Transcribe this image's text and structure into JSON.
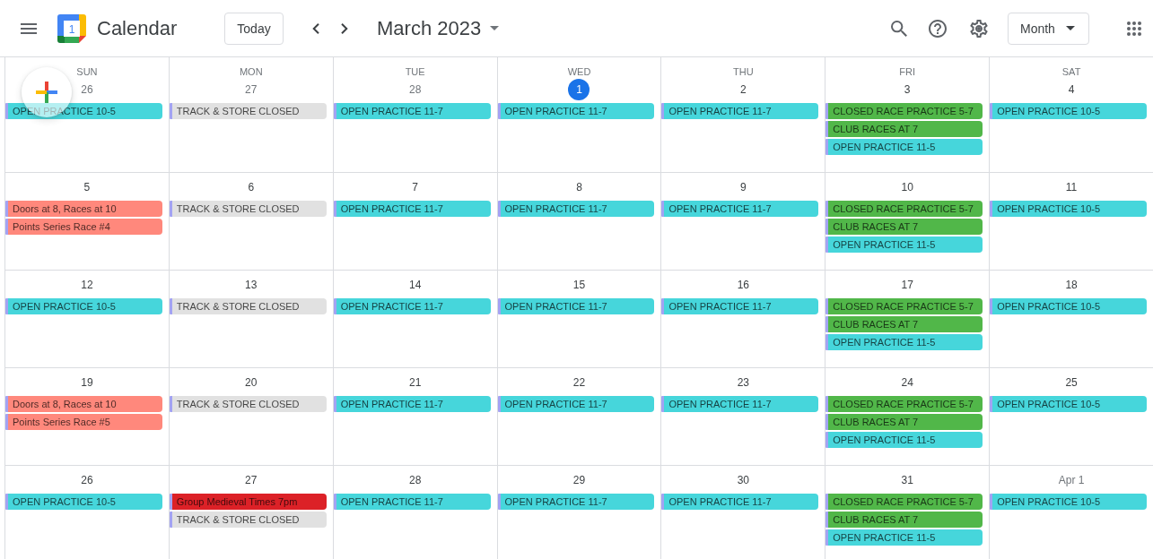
{
  "header": {
    "logo_number": "1",
    "app_name": "Calendar",
    "today_button": "Today",
    "period": "March 2023",
    "view_button": "Month"
  },
  "weekdays": [
    "SUN",
    "MON",
    "TUE",
    "WED",
    "THU",
    "FRI",
    "SAT"
  ],
  "weeks": [
    {
      "days": [
        {
          "date": "26",
          "in_month": false,
          "today": false,
          "events": [
            {
              "title": "OPEN PRACTICE 10-5",
              "color": "#46d6db"
            }
          ]
        },
        {
          "date": "27",
          "in_month": false,
          "today": false,
          "events": [
            {
              "title": "TRACK & STORE CLOSED",
              "color": "#e1e1e1"
            }
          ]
        },
        {
          "date": "28",
          "in_month": false,
          "today": false,
          "events": [
            {
              "title": "OPEN PRACTICE 11-7",
              "color": "#46d6db"
            }
          ]
        },
        {
          "date": "1",
          "in_month": true,
          "today": true,
          "events": [
            {
              "title": "OPEN PRACTICE 11-7",
              "color": "#46d6db"
            }
          ]
        },
        {
          "date": "2",
          "in_month": true,
          "today": false,
          "events": [
            {
              "title": "OPEN PRACTICE 11-7",
              "color": "#46d6db"
            }
          ]
        },
        {
          "date": "3",
          "in_month": true,
          "today": false,
          "events": [
            {
              "title": "CLOSED RACE PRACTICE 5-7",
              "color": "#51b749"
            },
            {
              "title": "CLUB RACES AT 7",
              "color": "#51b749"
            },
            {
              "title": "OPEN PRACTICE 11-5",
              "color": "#46d6db"
            }
          ]
        },
        {
          "date": "4",
          "in_month": true,
          "today": false,
          "events": [
            {
              "title": "OPEN PRACTICE 10-5",
              "color": "#46d6db"
            }
          ]
        }
      ]
    },
    {
      "days": [
        {
          "date": "5",
          "in_month": true,
          "today": false,
          "events": [
            {
              "title": "Doors at 8, Races at 10",
              "color": "#ff887c"
            },
            {
              "title": "Points Series Race #4",
              "color": "#ff887c"
            }
          ]
        },
        {
          "date": "6",
          "in_month": true,
          "today": false,
          "events": [
            {
              "title": "TRACK & STORE CLOSED",
              "color": "#e1e1e1"
            }
          ]
        },
        {
          "date": "7",
          "in_month": true,
          "today": false,
          "events": [
            {
              "title": "OPEN PRACTICE 11-7",
              "color": "#46d6db"
            }
          ]
        },
        {
          "date": "8",
          "in_month": true,
          "today": false,
          "events": [
            {
              "title": "OPEN PRACTICE 11-7",
              "color": "#46d6db"
            }
          ]
        },
        {
          "date": "9",
          "in_month": true,
          "today": false,
          "events": [
            {
              "title": "OPEN PRACTICE 11-7",
              "color": "#46d6db"
            }
          ]
        },
        {
          "date": "10",
          "in_month": true,
          "today": false,
          "events": [
            {
              "title": "CLOSED RACE PRACTICE 5-7",
              "color": "#51b749"
            },
            {
              "title": "CLUB RACES AT 7",
              "color": "#51b749"
            },
            {
              "title": "OPEN PRACTICE 11-5",
              "color": "#46d6db"
            }
          ]
        },
        {
          "date": "11",
          "in_month": true,
          "today": false,
          "events": [
            {
              "title": "OPEN PRACTICE 10-5",
              "color": "#46d6db"
            }
          ]
        }
      ]
    },
    {
      "days": [
        {
          "date": "12",
          "in_month": true,
          "today": false,
          "events": [
            {
              "title": "OPEN PRACTICE 10-5",
              "color": "#46d6db"
            }
          ]
        },
        {
          "date": "13",
          "in_month": true,
          "today": false,
          "events": [
            {
              "title": "TRACK & STORE CLOSED",
              "color": "#e1e1e1"
            }
          ]
        },
        {
          "date": "14",
          "in_month": true,
          "today": false,
          "events": [
            {
              "title": "OPEN PRACTICE 11-7",
              "color": "#46d6db"
            }
          ]
        },
        {
          "date": "15",
          "in_month": true,
          "today": false,
          "events": [
            {
              "title": "OPEN PRACTICE 11-7",
              "color": "#46d6db"
            }
          ]
        },
        {
          "date": "16",
          "in_month": true,
          "today": false,
          "events": [
            {
              "title": "OPEN PRACTICE 11-7",
              "color": "#46d6db"
            }
          ]
        },
        {
          "date": "17",
          "in_month": true,
          "today": false,
          "events": [
            {
              "title": "CLOSED RACE PRACTICE 5-7",
              "color": "#51b749"
            },
            {
              "title": "CLUB RACES AT 7",
              "color": "#51b749"
            },
            {
              "title": "OPEN PRACTICE 11-5",
              "color": "#46d6db"
            }
          ]
        },
        {
          "date": "18",
          "in_month": true,
          "today": false,
          "events": [
            {
              "title": "OPEN PRACTICE 10-5",
              "color": "#46d6db"
            }
          ]
        }
      ]
    },
    {
      "days": [
        {
          "date": "19",
          "in_month": true,
          "today": false,
          "events": [
            {
              "title": "Doors at 8, Races at 10",
              "color": "#ff887c"
            },
            {
              "title": "Points Series Race #5",
              "color": "#ff887c"
            }
          ]
        },
        {
          "date": "20",
          "in_month": true,
          "today": false,
          "events": [
            {
              "title": "TRACK & STORE CLOSED",
              "color": "#e1e1e1"
            }
          ]
        },
        {
          "date": "21",
          "in_month": true,
          "today": false,
          "events": [
            {
              "title": "OPEN PRACTICE 11-7",
              "color": "#46d6db"
            }
          ]
        },
        {
          "date": "22",
          "in_month": true,
          "today": false,
          "events": [
            {
              "title": "OPEN PRACTICE 11-7",
              "color": "#46d6db"
            }
          ]
        },
        {
          "date": "23",
          "in_month": true,
          "today": false,
          "events": [
            {
              "title": "OPEN PRACTICE 11-7",
              "color": "#46d6db"
            }
          ]
        },
        {
          "date": "24",
          "in_month": true,
          "today": false,
          "events": [
            {
              "title": "CLOSED RACE PRACTICE 5-7",
              "color": "#51b749"
            },
            {
              "title": "CLUB RACES AT 7",
              "color": "#51b749"
            },
            {
              "title": "OPEN PRACTICE 11-5",
              "color": "#46d6db"
            }
          ]
        },
        {
          "date": "25",
          "in_month": true,
          "today": false,
          "events": [
            {
              "title": "OPEN PRACTICE 10-5",
              "color": "#46d6db"
            }
          ]
        }
      ]
    },
    {
      "days": [
        {
          "date": "26",
          "in_month": true,
          "today": false,
          "events": [
            {
              "title": "OPEN PRACTICE 10-5",
              "color": "#46d6db"
            }
          ]
        },
        {
          "date": "27",
          "in_month": true,
          "today": false,
          "events": [
            {
              "title": "Group Medieval Times 7pm",
              "color": "#dc2127"
            },
            {
              "title": "TRACK & STORE CLOSED",
              "color": "#e1e1e1"
            }
          ]
        },
        {
          "date": "28",
          "in_month": true,
          "today": false,
          "events": [
            {
              "title": "OPEN PRACTICE 11-7",
              "color": "#46d6db"
            }
          ]
        },
        {
          "date": "29",
          "in_month": true,
          "today": false,
          "events": [
            {
              "title": "OPEN PRACTICE 11-7",
              "color": "#46d6db"
            }
          ]
        },
        {
          "date": "30",
          "in_month": true,
          "today": false,
          "events": [
            {
              "title": "OPEN PRACTICE 11-7",
              "color": "#46d6db"
            }
          ]
        },
        {
          "date": "31",
          "in_month": true,
          "today": false,
          "events": [
            {
              "title": "CLOSED RACE PRACTICE 5-7",
              "color": "#51b749"
            },
            {
              "title": "CLUB RACES AT 7",
              "color": "#51b749"
            },
            {
              "title": "OPEN PRACTICE 11-5",
              "color": "#46d6db"
            }
          ]
        },
        {
          "date": "Apr 1",
          "in_month": false,
          "today": false,
          "events": [
            {
              "title": "OPEN PRACTICE 10-5",
              "color": "#46d6db"
            }
          ]
        }
      ]
    }
  ]
}
